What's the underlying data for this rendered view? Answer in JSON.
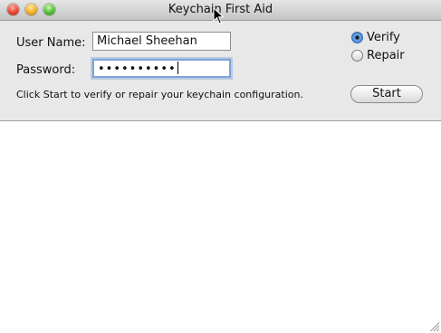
{
  "window": {
    "title": "Keychain First Aid",
    "controls": [
      "close-icon",
      "minimize-icon",
      "zoom-icon"
    ]
  },
  "form": {
    "username_label": "User Name:",
    "username_value": "Michael Sheehan",
    "password_label": "Password:",
    "password_value": "••••••••••",
    "hint_text": "Click Start to verify or repair your keychain configuration."
  },
  "mode": {
    "verify_label": "Verify",
    "repair_label": "Repair",
    "selected": "Verify"
  },
  "actions": {
    "start_label": "Start"
  },
  "output": {
    "text": ""
  },
  "icons": {
    "cursor": "arrow-cursor-icon",
    "resize": "resize-grip-icon"
  }
}
